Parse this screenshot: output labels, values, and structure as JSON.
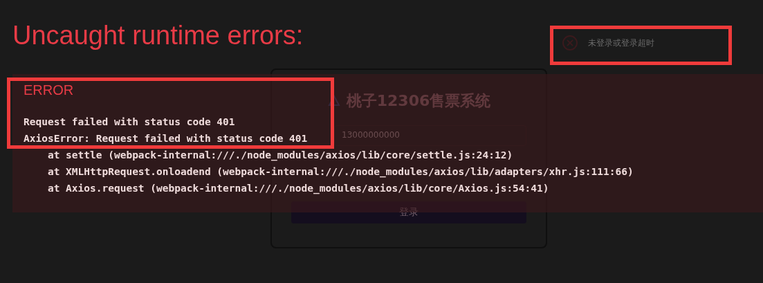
{
  "login_card": {
    "title": "桃子12306售票系统",
    "phone_field": {
      "value": "13000000000"
    },
    "login_button": "登录"
  },
  "toast": {
    "message": "未登录或登录超时"
  },
  "error_overlay": {
    "heading": "Uncaught runtime errors:",
    "label": "ERROR",
    "message": "Request failed with status code 401",
    "stack": [
      "AxiosError: Request failed with status code 401",
      "    at settle (webpack-internal:///./node_modules/axios/lib/core/settle.js:24:12)",
      "    at XMLHttpRequest.onloadend (webpack-internal:///./node_modules/axios/lib/adapters/xhr.js:111:66)",
      "    at Axios.request (webpack-internal:///./node_modules/axios/lib/core/Axios.js:54:41)"
    ]
  }
}
